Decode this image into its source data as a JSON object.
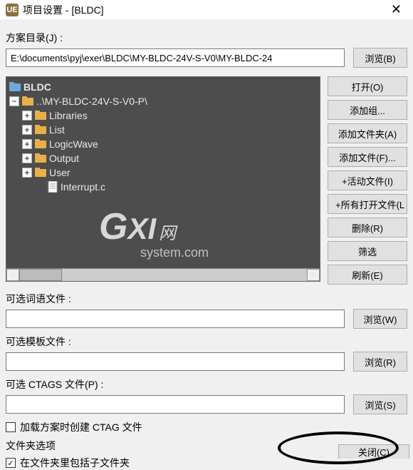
{
  "title_bar": {
    "logo_text": "UE",
    "title": "项目设置 - [BLDC]"
  },
  "labels": {
    "scheme_dir": "方案目录(J) :",
    "word_file": "可选词语文件 :",
    "tpl_file": "可选模板文件 :",
    "ctags_file": "可选 CTAGS 文件(P) :",
    "folder_options": "文件夹选项"
  },
  "path_input": {
    "value": "E:\\documents\\pyj\\exer\\BLDC\\MY-BLDC-24V-S-V0\\MY-BLDC-24"
  },
  "buttons": {
    "browse_b": "浏览(B)",
    "open": "打开(O)",
    "add_group": "添加组...",
    "add_folder": "添加文件夹(A)",
    "add_file": "添加文件(F)...",
    "active_file": "+活动文件(I)",
    "all_open": "+所有打开文件(L",
    "delete": "删除(R)",
    "filter": "筛选",
    "refresh": "刷新(E)",
    "browse_w": "浏览(W)",
    "browse_r": "浏览(R)",
    "browse_s": "浏览(S)",
    "close": "关闭(C)"
  },
  "tree": {
    "root": "BLDC",
    "sub": "..\\MY-BLDC-24V-S-V0-P\\",
    "items": [
      "Libraries",
      "List",
      "LogicWave",
      "Output",
      "User"
    ],
    "file": "Interrupt.c"
  },
  "checkboxes": {
    "load_ctag": "加载方案时创建 CTAG 文件",
    "include_sub": "在文件夹里包括子文件夹"
  },
  "watermark": {
    "g": "G",
    "xi": "XI",
    "cn": "网",
    "sys": "system.com"
  }
}
